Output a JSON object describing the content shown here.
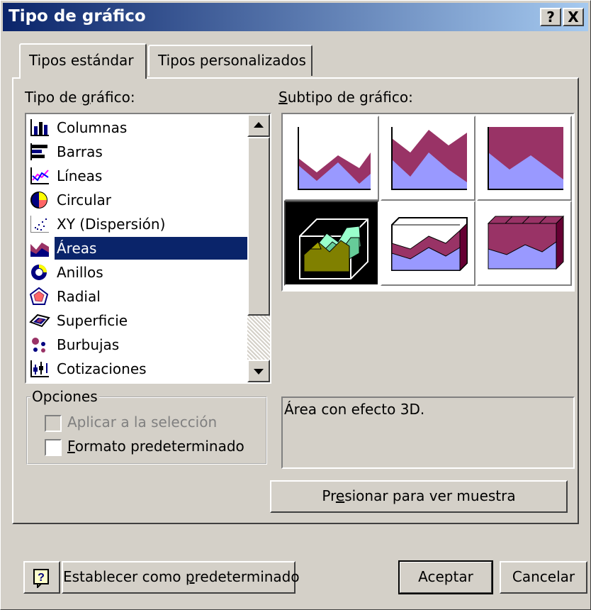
{
  "window": {
    "title": "Tipo de gráfico",
    "help_label": "?",
    "close_label": "X"
  },
  "tabs": [
    {
      "label": "Tipos estándar",
      "active": true
    },
    {
      "label": "Tipos personalizados",
      "active": false
    }
  ],
  "chart_type": {
    "label_pre": "Tipo de ",
    "label_ul": "g",
    "label_post": "ráfico:",
    "items": [
      {
        "label": "Columnas",
        "icon": "column-chart-icon"
      },
      {
        "label": "Barras",
        "icon": "bar-chart-icon"
      },
      {
        "label": "Líneas",
        "icon": "line-chart-icon"
      },
      {
        "label": "Circular",
        "icon": "pie-chart-icon"
      },
      {
        "label": "XY (Dispersión)",
        "icon": "scatter-chart-icon"
      },
      {
        "label": "Áreas",
        "icon": "area-chart-icon",
        "selected": true
      },
      {
        "label": "Anillos",
        "icon": "doughnut-chart-icon"
      },
      {
        "label": "Radial",
        "icon": "radar-chart-icon"
      },
      {
        "label": "Superficie",
        "icon": "surface-chart-icon"
      },
      {
        "label": "Burbujas",
        "icon": "bubble-chart-icon"
      },
      {
        "label": "Cotizaciones",
        "icon": "stock-chart-icon"
      }
    ]
  },
  "subtype": {
    "label_ul": "S",
    "label_post": "ubtipo de gráfico:",
    "selected_index": 3,
    "colors": {
      "area_blue": "#9999ff",
      "area_purple": "#993366",
      "area3d_green": "#99ffcc",
      "area3d_olive": "#808000"
    }
  },
  "options": {
    "title": "Opciones",
    "apply_label": "Aplicar a la selección",
    "default_format_ul": "F",
    "default_format_post": "ormato predeterminado"
  },
  "description": "Área con efecto 3D.",
  "buttons": {
    "preview_pre": "Pr",
    "preview_ul": "e",
    "preview_post": "sionar para ver muestra",
    "help_icon_label": "?",
    "set_default_pre": "Establecer como ",
    "set_default_ul": "p",
    "set_default_post": "redeterminado",
    "ok": "Aceptar",
    "cancel": "Cancelar"
  }
}
